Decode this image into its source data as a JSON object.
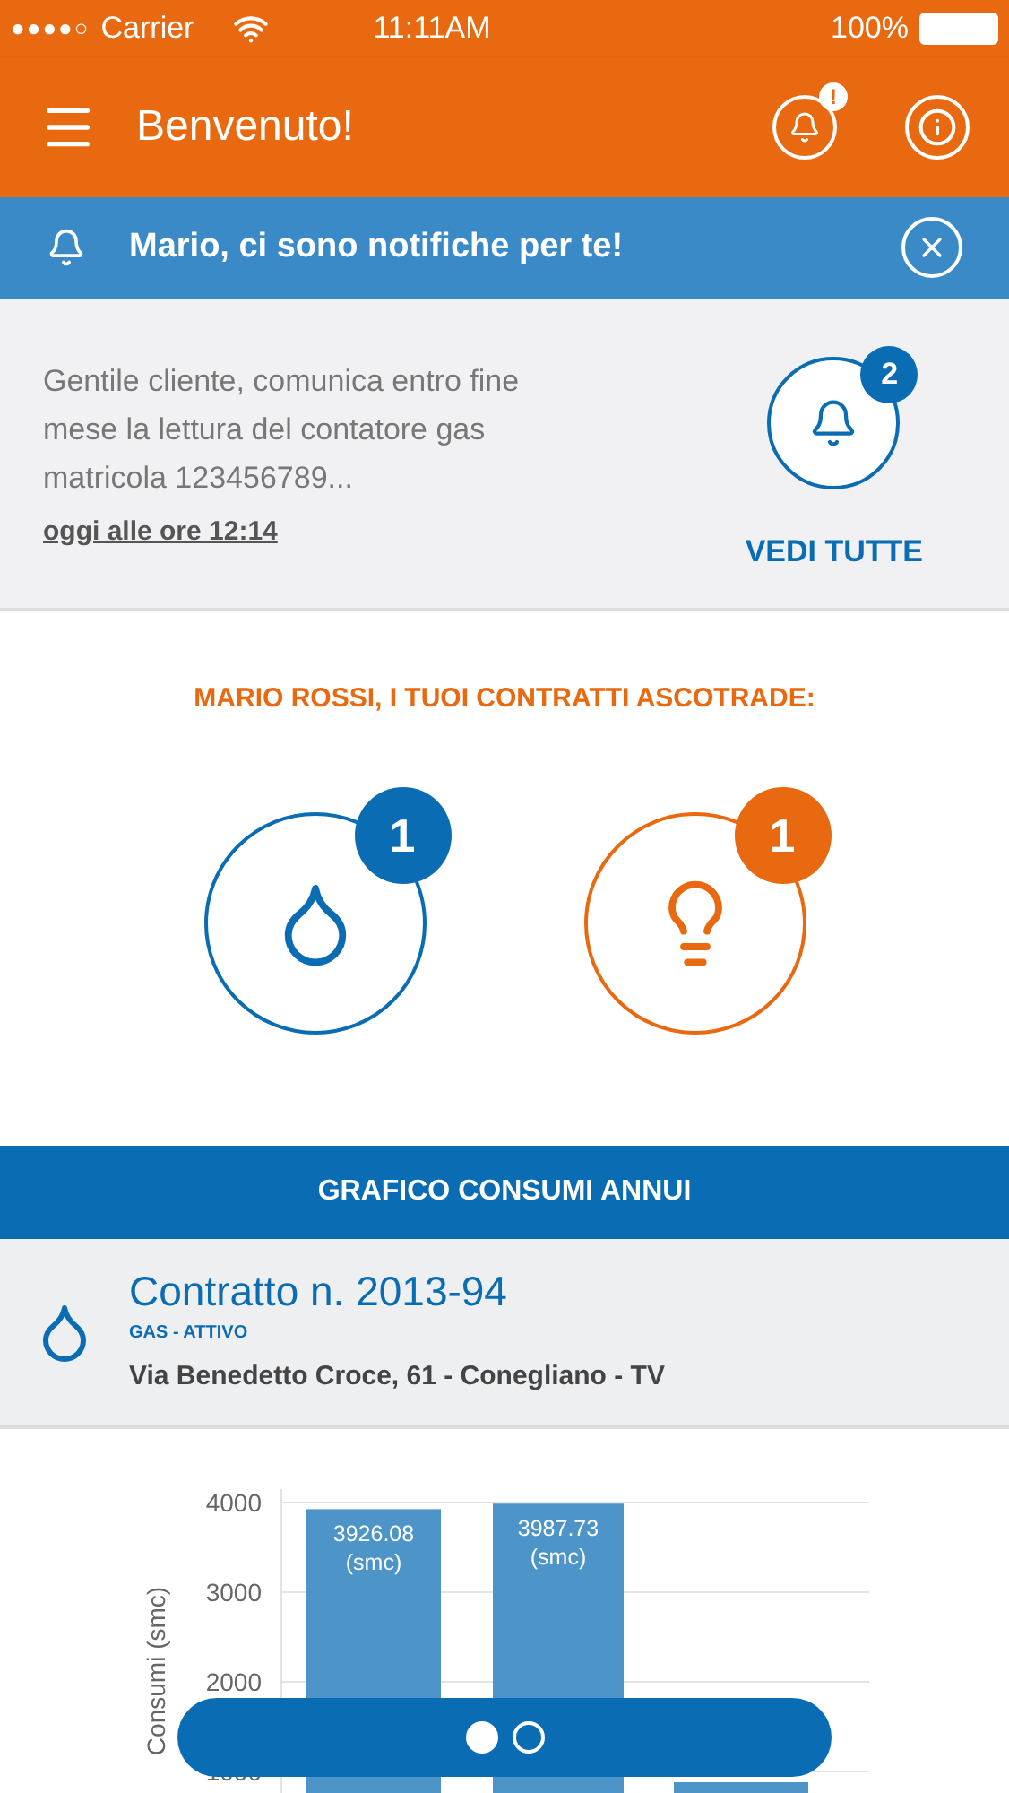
{
  "status_bar": {
    "signal_dots": "●●●●○",
    "carrier": "Carrier",
    "time": "11:11AM",
    "battery": "100%"
  },
  "header": {
    "title": "Benvenuto!",
    "alert_badge": "!"
  },
  "notification_bar": {
    "message": "Mario, ci sono notifiche per te!"
  },
  "notice": {
    "text": "Gentile cliente, comunica entro fine mese la lettura del contatore gas matricola 123456789...",
    "date": "oggi alle ore 12:14",
    "count": "2",
    "link": "VEDI TUTTE"
  },
  "contracts": {
    "heading": "MARIO ROSSI, I TUOI CONTRATTI ASCOTRADE:",
    "items": [
      {
        "kind": "gas",
        "count": "1",
        "color": "#0a6db3"
      },
      {
        "kind": "light",
        "count": "1",
        "color": "#e8690f"
      }
    ]
  },
  "chart_banner": {
    "label": "GRAFICO CONSUMI ANNUI"
  },
  "contract_info": {
    "title": "Contratto n. 2013-94",
    "status": "GAS - ATTIVO",
    "address": "Via Benedetto Croce, 61 - Conegliano - TV"
  },
  "chart_data": {
    "type": "bar",
    "ylabel": "Consumi (smc)",
    "values": [
      3926.08,
      3987.73,
      880
    ],
    "ylim": [
      760,
      4150
    ],
    "grid": true,
    "yticks": [
      1000,
      2000,
      3000,
      4000
    ],
    "value_labels": [
      "3926.08 (smc)",
      "3987.73 (smc)",
      null
    ]
  },
  "pager": {
    "dots": [
      {
        "selected": true
      },
      {
        "selected": false
      }
    ]
  }
}
